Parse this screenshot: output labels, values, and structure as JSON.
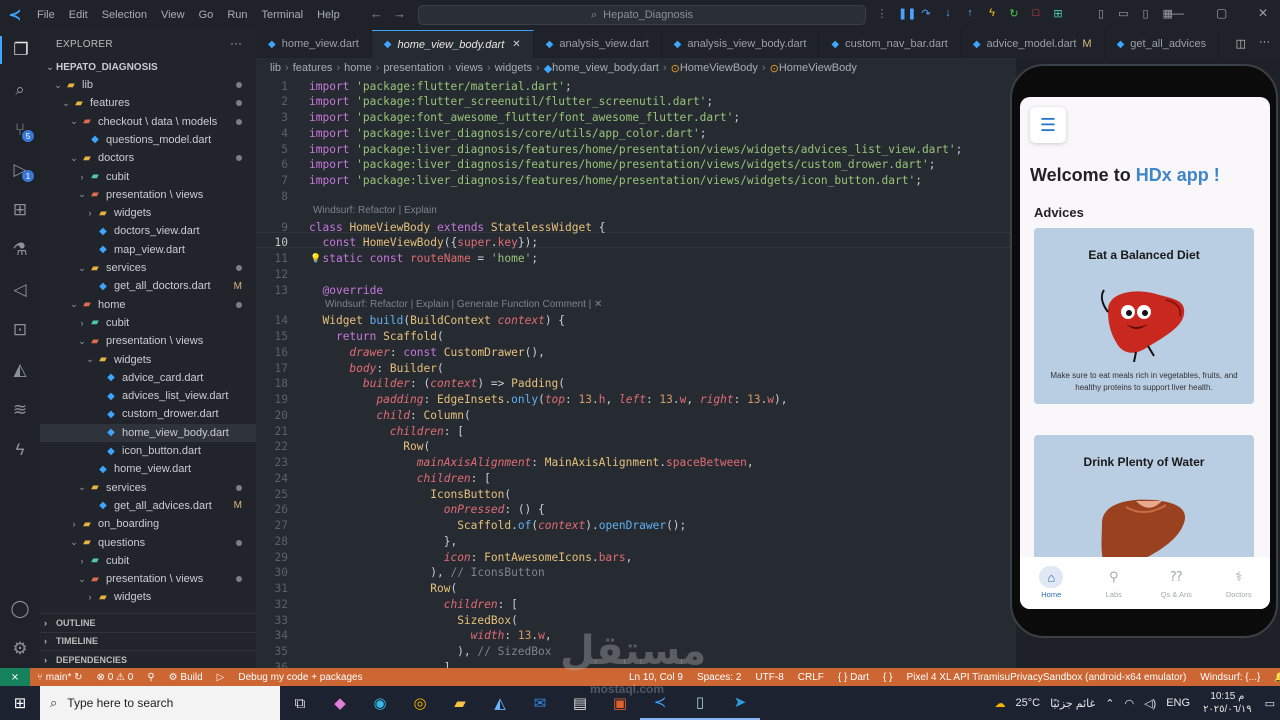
{
  "titlebar": {
    "menu": [
      "File",
      "Edit",
      "Selection",
      "View",
      "Go",
      "Run",
      "Terminal",
      "Help"
    ],
    "search_text": "Hepato_Diagnosis"
  },
  "explorer": {
    "header": "EXPLORER",
    "project": "HEPATO_DIAGNOSIS",
    "tree": [
      {
        "label": "lib",
        "kind": "folder",
        "depth": 1,
        "dot": true
      },
      {
        "label": "features",
        "kind": "folder",
        "depth": 2,
        "dot": true
      },
      {
        "label": "checkout \\ data \\ models",
        "kind": "folder",
        "depth": 3,
        "dot": true
      },
      {
        "label": "questions_model.dart",
        "kind": "file",
        "depth": 4
      },
      {
        "label": "doctors",
        "kind": "folder",
        "depth": 3,
        "dot": true
      },
      {
        "label": "cubit",
        "kind": "folder-closed",
        "depth": 4
      },
      {
        "label": "presentation \\ views",
        "kind": "folder",
        "depth": 4
      },
      {
        "label": "widgets",
        "kind": "folder-closed",
        "depth": 5
      },
      {
        "label": "doctors_view.dart",
        "kind": "file",
        "depth": 5
      },
      {
        "label": "map_view.dart",
        "kind": "file",
        "depth": 5
      },
      {
        "label": "services",
        "kind": "folder",
        "depth": 4,
        "dot": true
      },
      {
        "label": "get_all_doctors.dart",
        "kind": "file",
        "depth": 5,
        "flag": "M"
      },
      {
        "label": "home",
        "kind": "folder",
        "depth": 3,
        "dot": true
      },
      {
        "label": "cubit",
        "kind": "folder-closed",
        "depth": 4
      },
      {
        "label": "presentation \\ views",
        "kind": "folder",
        "depth": 4
      },
      {
        "label": "widgets",
        "kind": "folder",
        "depth": 5
      },
      {
        "label": "advice_card.dart",
        "kind": "file",
        "depth": 6
      },
      {
        "label": "advices_list_view.dart",
        "kind": "file",
        "depth": 6
      },
      {
        "label": "custom_drower.dart",
        "kind": "file",
        "depth": 6
      },
      {
        "label": "home_view_body.dart",
        "kind": "file",
        "depth": 6,
        "selected": true
      },
      {
        "label": "icon_button.dart",
        "kind": "file",
        "depth": 6
      },
      {
        "label": "home_view.dart",
        "kind": "file",
        "depth": 5
      },
      {
        "label": "services",
        "kind": "folder",
        "depth": 4,
        "dot": true
      },
      {
        "label": "get_all_advices.dart",
        "kind": "file",
        "depth": 5,
        "flag": "M"
      },
      {
        "label": "on_boarding",
        "kind": "folder-closed",
        "depth": 3
      },
      {
        "label": "questions",
        "kind": "folder",
        "depth": 3,
        "dot": true
      },
      {
        "label": "cubit",
        "kind": "folder-closed",
        "depth": 4
      },
      {
        "label": "presentation \\ views",
        "kind": "folder",
        "depth": 4,
        "dot": true
      },
      {
        "label": "widgets",
        "kind": "folder-closed",
        "depth": 5
      }
    ],
    "sections": [
      "OUTLINE",
      "TIMELINE",
      "DEPENDENCIES"
    ]
  },
  "tabs": [
    {
      "label": "home_view.dart"
    },
    {
      "label": "home_view_body.dart",
      "active": true
    },
    {
      "label": "analysis_view.dart"
    },
    {
      "label": "analysis_view_body.dart"
    },
    {
      "label": "custom_nav_bar.dart"
    },
    {
      "label": "advice_model.dart",
      "flag": "M"
    },
    {
      "label": "get_all_advices"
    }
  ],
  "breadcrumb": [
    "lib",
    "features",
    "home",
    "presentation",
    "views",
    "widgets",
    "home_view_body.dart",
    "HomeViewBody",
    "HomeViewBody"
  ],
  "editor": {
    "lines": [
      {
        "n": "1",
        "html": "<span style='color:#c678dd'>import</span> <span style='color:#98c379'>'package:flutter/material.dart'</span>;"
      },
      {
        "n": "2",
        "html": "<span style='color:#c678dd'>import</span> <span style='color:#98c379'>'package:flutter_screenutil/flutter_screenutil.dart'</span>;"
      },
      {
        "n": "3",
        "html": "<span style='color:#c678dd'>import</span> <span style='color:#98c379'>'package:font_awesome_flutter/font_awesome_flutter.dart'</span>;"
      },
      {
        "n": "4",
        "html": "<span style='color:#c678dd'>import</span> <span style='color:#98c379'>'package:liver_diagnosis/core/utils/app_color.dart'</span>;"
      },
      {
        "n": "5",
        "html": "<span style='color:#c678dd'>import</span> <span style='color:#98c379'>'package:liver_diagnosis/features/home/presentation/views/widgets/advices_list_view.dart'</span>;"
      },
      {
        "n": "6",
        "html": "<span style='color:#c678dd'>import</span> <span style='color:#98c379'>'package:liver_diagnosis/features/home/presentation/views/widgets/custom_drower.dart'</span>;"
      },
      {
        "n": "7",
        "html": "<span style='color:#c678dd'>import</span> <span style='color:#98c379'>'package:liver_diagnosis/features/home/presentation/views/widgets/icon_button.dart'</span>;"
      },
      {
        "n": "8",
        "html": ""
      },
      {
        "n": "9",
        "html": "<span style='color:#c678dd'>class</span> <span style='color:#e5c07b'>HomeViewBody</span> <span style='color:#c678dd'>extends</span> <span style='color:#e5c07b'>StatelessWidget</span> {"
      },
      {
        "n": "10",
        "html": "  <span style='color:#c678dd'>const</span> <span style='color:#e5c07b'>HomeViewBody</span>({<span style='color:#e06c75'>super</span>.<span style='color:#e06c75'>key</span>});"
      },
      {
        "n": "11",
        "html": "  <span style='color:#c678dd'>static const</span> <span style='color:#e06c75'>routeName</span> = <span style='color:#98c379'>'home'</span>;"
      },
      {
        "n": "12",
        "html": ""
      },
      {
        "n": "13",
        "html": "  <span style='color:#c678dd'>@override</span>"
      },
      {
        "n": "14",
        "html": "  <span style='color:#e5c07b'>Widget</span> <span style='color:#61afef'>build</span>(<span style='color:#e5c07b'>BuildContext</span> <i style='color:#e06c75'>context</i>) {"
      },
      {
        "n": "15",
        "html": "    <span style='color:#c678dd'>return</span> <span style='color:#e5c07b'>Scaffold</span>("
      },
      {
        "n": "16",
        "html": "      <i style='color:#e06c75'>drawer</i>: <span style='color:#c678dd'>const</span> <span style='color:#e5c07b'>CustomDrawer</span>(),"
      },
      {
        "n": "17",
        "html": "      <i style='color:#e06c75'>body</i>: <span style='color:#e5c07b'>Builder</span>("
      },
      {
        "n": "18",
        "html": "        <i style='color:#e06c75'>builder</i>: (<i style='color:#e06c75'>context</i>) => <span style='color:#e5c07b'>Padding</span>("
      },
      {
        "n": "19",
        "html": "          <i style='color:#e06c75'>padding</i>: <span style='color:#e5c07b'>EdgeInsets</span>.<span style='color:#61afef'>only</span>(<i style='color:#e06c75'>top</i>: <span style='color:#d19a66'>13</span>.<span style='color:#e06c75'>h</span>, <i style='color:#e06c75'>left</i>: <span style='color:#d19a66'>13</span>.<span style='color:#e06c75'>w</span>, <i style='color:#e06c75'>right</i>: <span style='color:#d19a66'>13</span>.<span style='color:#e06c75'>w</span>),"
      },
      {
        "n": "20",
        "html": "          <i style='color:#e06c75'>child</i>: <span style='color:#e5c07b'>Column</span>("
      },
      {
        "n": "21",
        "html": "            <i style='color:#e06c75'>children</i>: ["
      },
      {
        "n": "22",
        "html": "              <span style='color:#e5c07b'>Row</span>("
      },
      {
        "n": "23",
        "html": "                <i style='color:#e06c75'>mainAxisAlignment</i>: <span style='color:#e5c07b'>MainAxisAlignment</span>.<span style='color:#e06c75'>spaceBetween</span>,"
      },
      {
        "n": "24",
        "html": "                <i style='color:#e06c75'>children</i>: ["
      },
      {
        "n": "25",
        "html": "                  <span style='color:#e5c07b'>IconsButton</span>("
      },
      {
        "n": "26",
        "html": "                    <i style='color:#e06c75'>onPressed</i>: () {"
      },
      {
        "n": "27",
        "html": "                      <span style='color:#e5c07b'>Scaffold</span>.<span style='color:#61afef'>of</span>(<i style='color:#e06c75'>context</i>).<span style='color:#61afef'>openDrawer</span>();"
      },
      {
        "n": "28",
        "html": "                    },"
      },
      {
        "n": "29",
        "html": "                    <i style='color:#e06c75'>icon</i>: <span style='color:#e5c07b'>FontAwesomeIcons</span>.<span style='color:#e06c75'>bars</span>,"
      },
      {
        "n": "30",
        "html": "                  ), <span style='color:#7f848e'>// IconsButton</span>"
      },
      {
        "n": "31",
        "html": "                  <span style='color:#e5c07b'>Row</span>("
      },
      {
        "n": "32",
        "html": "                    <i style='color:#e06c75'>children</i>: ["
      },
      {
        "n": "33",
        "html": "                      <span style='color:#e5c07b'>SizedBox</span>("
      },
      {
        "n": "34",
        "html": "                        <i style='color:#e06c75'>width</i>: <span style='color:#d19a66'>13</span>.<span style='color:#e06c75'>w</span>,"
      },
      {
        "n": "35",
        "html": "                      ), <span style='color:#7f848e'>// SizedBox</span>"
      },
      {
        "n": "36",
        "html": "                    ],"
      }
    ],
    "lens_class": "Windsurf: Refactor | Explain",
    "lens_method": "Windsurf: Refactor | Explain | Generate Function Comment | ✕"
  },
  "app": {
    "welcome_prefix": "Welcome to ",
    "welcome_highlight": "HDx app !",
    "advices_title": "Advices",
    "cards": [
      {
        "title": "Eat a Balanced Diet",
        "text": "Make sure to eat meals rich in vegetables, fruits, and healthy proteins to support liver health."
      },
      {
        "title": "Drink Plenty of Water",
        "text": ""
      }
    ],
    "nav": [
      {
        "label": "Home",
        "active": true,
        "icon": "home-icon"
      },
      {
        "label": "Labs",
        "icon": "labs-icon"
      },
      {
        "label": "Qs & Ans",
        "icon": "qa-icon"
      },
      {
        "label": "Doctors",
        "icon": "doctors-icon"
      }
    ]
  },
  "statusbar": {
    "branch": "main*",
    "problems": "⊗ 0 ⚠ 0",
    "build": "Build",
    "debug": "Debug my code + packages",
    "position": "Ln 10, Col 9",
    "spaces": "Spaces: 2",
    "encoding": "UTF-8",
    "eol": "CRLF",
    "language": "Dart",
    "device": "Pixel 4 XL API TiramisuPrivacySandbox (android-x64 emulator)",
    "windsurf": "Windsurf: {...}"
  },
  "taskbar": {
    "search_placeholder": "Type here to search",
    "weather": "25°C",
    "weather_text": "غائم جزئيًا",
    "lang": "ENG",
    "time": "10:15 م",
    "date": "٢٠٢٥/٠٦/١٩"
  },
  "watermark": {
    "text": "مستقل",
    "sub": "mostaql.com"
  },
  "colors": {
    "accent": "#3ea6ff",
    "statusbar": "#cc6633",
    "card": "#b9cde3"
  }
}
